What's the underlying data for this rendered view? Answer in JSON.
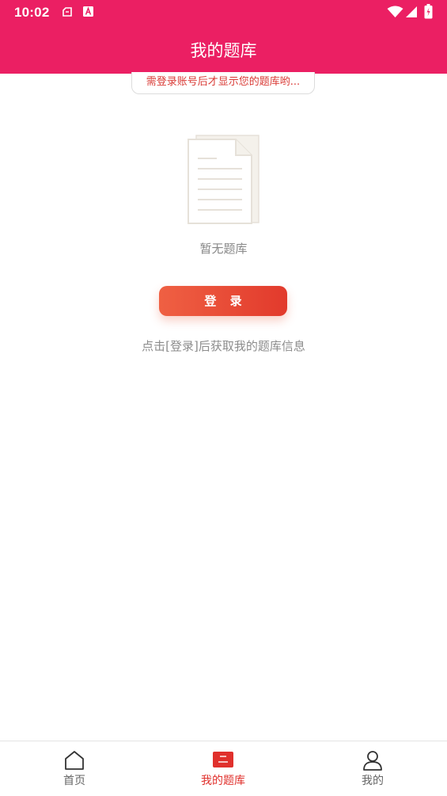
{
  "status_bar": {
    "time": "10:02"
  },
  "header": {
    "title": "我的题库"
  },
  "notice": {
    "text": "需登录账号后才显示您的题库哟..."
  },
  "empty_state": {
    "text": "暂无题库"
  },
  "login": {
    "button_label": "登 录",
    "hint": "点击[登录]后获取我的题库信息"
  },
  "bottom_nav": {
    "items": [
      {
        "label": "首页",
        "icon": "home-icon",
        "active": false
      },
      {
        "label": "我的题库",
        "icon": "question-bank-icon",
        "active": true
      },
      {
        "label": "我的",
        "icon": "user-icon",
        "active": false
      }
    ]
  },
  "colors": {
    "header_bg": "#eb1f63",
    "accent": "#e0302c",
    "button_gradient": [
      "#ef6043",
      "#e23a2c"
    ]
  }
}
